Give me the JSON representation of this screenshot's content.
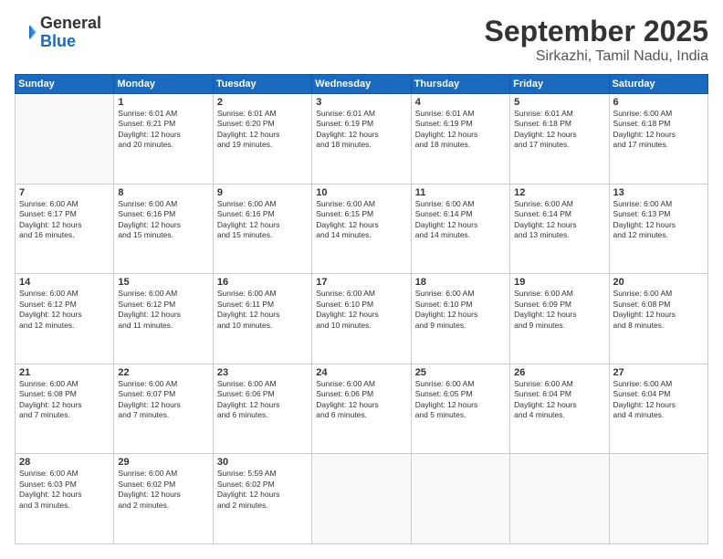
{
  "header": {
    "logo_general": "General",
    "logo_blue": "Blue",
    "month_title": "September 2025",
    "subtitle": "Sirkazhi, Tamil Nadu, India"
  },
  "days_of_week": [
    "Sunday",
    "Monday",
    "Tuesday",
    "Wednesday",
    "Thursday",
    "Friday",
    "Saturday"
  ],
  "weeks": [
    [
      {
        "day": "",
        "info": ""
      },
      {
        "day": "1",
        "info": "Sunrise: 6:01 AM\nSunset: 6:21 PM\nDaylight: 12 hours\nand 20 minutes."
      },
      {
        "day": "2",
        "info": "Sunrise: 6:01 AM\nSunset: 6:20 PM\nDaylight: 12 hours\nand 19 minutes."
      },
      {
        "day": "3",
        "info": "Sunrise: 6:01 AM\nSunset: 6:19 PM\nDaylight: 12 hours\nand 18 minutes."
      },
      {
        "day": "4",
        "info": "Sunrise: 6:01 AM\nSunset: 6:19 PM\nDaylight: 12 hours\nand 18 minutes."
      },
      {
        "day": "5",
        "info": "Sunrise: 6:01 AM\nSunset: 6:18 PM\nDaylight: 12 hours\nand 17 minutes."
      },
      {
        "day": "6",
        "info": "Sunrise: 6:00 AM\nSunset: 6:18 PM\nDaylight: 12 hours\nand 17 minutes."
      }
    ],
    [
      {
        "day": "7",
        "info": "Sunrise: 6:00 AM\nSunset: 6:17 PM\nDaylight: 12 hours\nand 16 minutes."
      },
      {
        "day": "8",
        "info": "Sunrise: 6:00 AM\nSunset: 6:16 PM\nDaylight: 12 hours\nand 15 minutes."
      },
      {
        "day": "9",
        "info": "Sunrise: 6:00 AM\nSunset: 6:16 PM\nDaylight: 12 hours\nand 15 minutes."
      },
      {
        "day": "10",
        "info": "Sunrise: 6:00 AM\nSunset: 6:15 PM\nDaylight: 12 hours\nand 14 minutes."
      },
      {
        "day": "11",
        "info": "Sunrise: 6:00 AM\nSunset: 6:14 PM\nDaylight: 12 hours\nand 14 minutes."
      },
      {
        "day": "12",
        "info": "Sunrise: 6:00 AM\nSunset: 6:14 PM\nDaylight: 12 hours\nand 13 minutes."
      },
      {
        "day": "13",
        "info": "Sunrise: 6:00 AM\nSunset: 6:13 PM\nDaylight: 12 hours\nand 12 minutes."
      }
    ],
    [
      {
        "day": "14",
        "info": "Sunrise: 6:00 AM\nSunset: 6:12 PM\nDaylight: 12 hours\nand 12 minutes."
      },
      {
        "day": "15",
        "info": "Sunrise: 6:00 AM\nSunset: 6:12 PM\nDaylight: 12 hours\nand 11 minutes."
      },
      {
        "day": "16",
        "info": "Sunrise: 6:00 AM\nSunset: 6:11 PM\nDaylight: 12 hours\nand 10 minutes."
      },
      {
        "day": "17",
        "info": "Sunrise: 6:00 AM\nSunset: 6:10 PM\nDaylight: 12 hours\nand 10 minutes."
      },
      {
        "day": "18",
        "info": "Sunrise: 6:00 AM\nSunset: 6:10 PM\nDaylight: 12 hours\nand 9 minutes."
      },
      {
        "day": "19",
        "info": "Sunrise: 6:00 AM\nSunset: 6:09 PM\nDaylight: 12 hours\nand 9 minutes."
      },
      {
        "day": "20",
        "info": "Sunrise: 6:00 AM\nSunset: 6:08 PM\nDaylight: 12 hours\nand 8 minutes."
      }
    ],
    [
      {
        "day": "21",
        "info": "Sunrise: 6:00 AM\nSunset: 6:08 PM\nDaylight: 12 hours\nand 7 minutes."
      },
      {
        "day": "22",
        "info": "Sunrise: 6:00 AM\nSunset: 6:07 PM\nDaylight: 12 hours\nand 7 minutes."
      },
      {
        "day": "23",
        "info": "Sunrise: 6:00 AM\nSunset: 6:06 PM\nDaylight: 12 hours\nand 6 minutes."
      },
      {
        "day": "24",
        "info": "Sunrise: 6:00 AM\nSunset: 6:06 PM\nDaylight: 12 hours\nand 6 minutes."
      },
      {
        "day": "25",
        "info": "Sunrise: 6:00 AM\nSunset: 6:05 PM\nDaylight: 12 hours\nand 5 minutes."
      },
      {
        "day": "26",
        "info": "Sunrise: 6:00 AM\nSunset: 6:04 PM\nDaylight: 12 hours\nand 4 minutes."
      },
      {
        "day": "27",
        "info": "Sunrise: 6:00 AM\nSunset: 6:04 PM\nDaylight: 12 hours\nand 4 minutes."
      }
    ],
    [
      {
        "day": "28",
        "info": "Sunrise: 6:00 AM\nSunset: 6:03 PM\nDaylight: 12 hours\nand 3 minutes."
      },
      {
        "day": "29",
        "info": "Sunrise: 6:00 AM\nSunset: 6:02 PM\nDaylight: 12 hours\nand 2 minutes."
      },
      {
        "day": "30",
        "info": "Sunrise: 5:59 AM\nSunset: 6:02 PM\nDaylight: 12 hours\nand 2 minutes."
      },
      {
        "day": "",
        "info": ""
      },
      {
        "day": "",
        "info": ""
      },
      {
        "day": "",
        "info": ""
      },
      {
        "day": "",
        "info": ""
      }
    ]
  ]
}
